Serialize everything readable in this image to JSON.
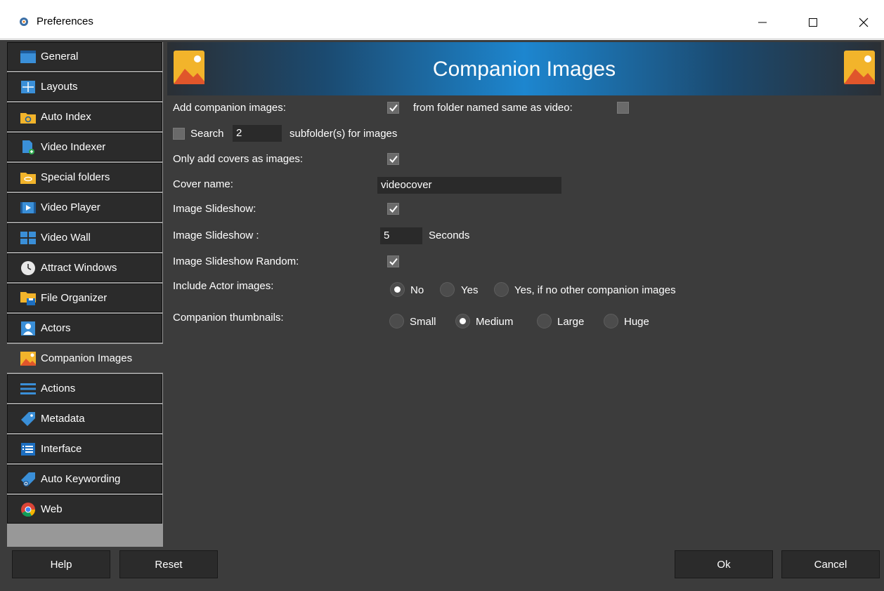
{
  "window": {
    "title": "Preferences",
    "app_icon": "gear-icon"
  },
  "sidebar": {
    "items": [
      {
        "label": "General",
        "icon": "window-icon"
      },
      {
        "label": "Layouts",
        "icon": "layouts-icon"
      },
      {
        "label": "Auto Index",
        "icon": "folder-refresh-icon"
      },
      {
        "label": "Video Indexer",
        "icon": "document-add-icon"
      },
      {
        "label": "Special folders",
        "icon": "folder-link-icon"
      },
      {
        "label": "Video Player",
        "icon": "video-player-icon"
      },
      {
        "label": "Video Wall",
        "icon": "video-wall-icon"
      },
      {
        "label": "Attract Windows",
        "icon": "clock-icon"
      },
      {
        "label": "File Organizer",
        "icon": "folder-save-icon"
      },
      {
        "label": "Actors",
        "icon": "person-icon"
      },
      {
        "label": "Companion Images",
        "icon": "picture-icon",
        "active": true
      },
      {
        "label": "Actions",
        "icon": "list-icon"
      },
      {
        "label": "Metadata",
        "icon": "tag-icon"
      },
      {
        "label": "Interface",
        "icon": "interface-icon"
      },
      {
        "label": "Auto Keywording",
        "icon": "tag-refresh-icon"
      },
      {
        "label": "Web",
        "icon": "chrome-icon"
      }
    ]
  },
  "panel": {
    "title": "Companion Images",
    "add_companion_images": {
      "label": "Add companion images:",
      "checked": true
    },
    "from_folder": {
      "label": "from folder named same as video:",
      "checked": false
    },
    "search": {
      "label": "Search",
      "value": "2",
      "suffix": "subfolder(s) for images",
      "checked": false
    },
    "only_covers": {
      "label": "Only add covers as images:",
      "checked": true
    },
    "cover_name": {
      "label": "Cover name:",
      "value": "videocover"
    },
    "slideshow": {
      "label": "Image Slideshow:",
      "checked": true
    },
    "slideshow_seconds": {
      "label": "Image Slideshow :",
      "value": "5",
      "unit": "Seconds"
    },
    "slideshow_random": {
      "label": "Image Slideshow Random:",
      "checked": true
    },
    "actor_images": {
      "label": "Include Actor images:",
      "options": [
        "No",
        "Yes",
        "Yes, if no other companion images"
      ],
      "selected": "No"
    },
    "thumbnails": {
      "label": "Companion thumbnails:",
      "options": [
        "Small",
        "Medium",
        "Large",
        "Huge"
      ],
      "selected": "Medium"
    }
  },
  "buttons": {
    "help": "Help",
    "reset": "Reset",
    "ok": "Ok",
    "cancel": "Cancel"
  },
  "colors": {
    "accent": "#1d86cf",
    "background": "#3c3c3c",
    "nav_bg": "#2b2b2b"
  }
}
